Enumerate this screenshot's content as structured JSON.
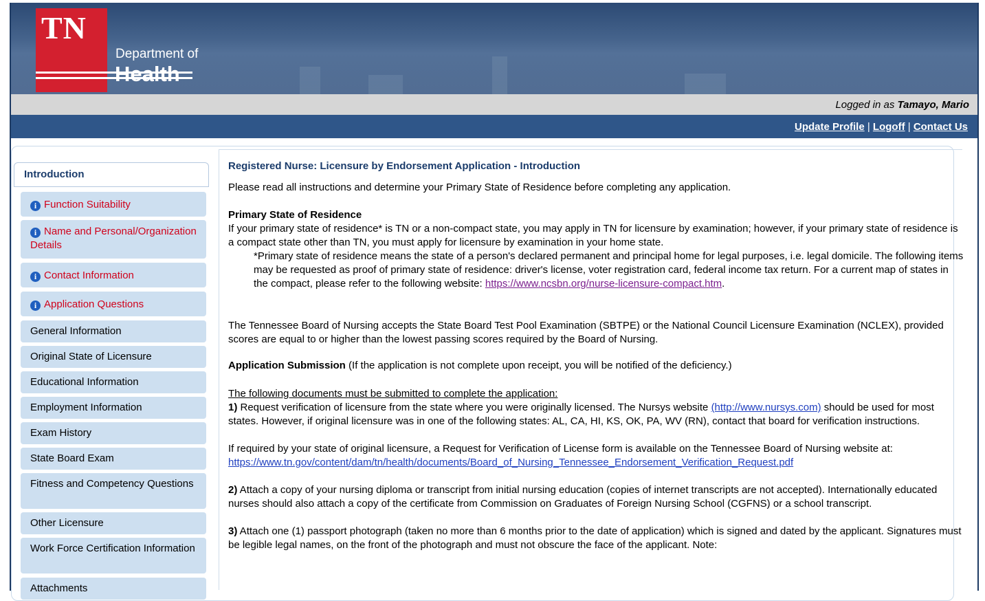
{
  "header": {
    "logo_abbrev": "TN",
    "logo_dept": "Department of",
    "logo_name": "Health",
    "logged_in_prefix": "Logged in as ",
    "logged_in_user": "Tamayo, Mario",
    "nav_links": [
      "Update Profile",
      "Logoff",
      "Contact Us"
    ],
    "nav_separator": "|"
  },
  "sidebar": {
    "active_tab": "Introduction",
    "items": [
      {
        "label": "Function Suitability",
        "warning": true
      },
      {
        "label": "Name and Personal/Organization Details",
        "warning": true
      },
      {
        "label": "Contact Information",
        "warning": true
      },
      {
        "label": "Application Questions",
        "warning": true
      },
      {
        "label": "General Information",
        "warning": false
      },
      {
        "label": "Original State of Licensure",
        "warning": false
      },
      {
        "label": "Educational Information",
        "warning": false
      },
      {
        "label": "Employment Information",
        "warning": false
      },
      {
        "label": "Exam History",
        "warning": false
      },
      {
        "label": "State Board Exam",
        "warning": false
      },
      {
        "label": "Fitness and Competency Questions",
        "warning": false
      },
      {
        "label": "Other Licensure",
        "warning": false
      },
      {
        "label": "Work Force Certification Information",
        "warning": false
      },
      {
        "label": "Attachments",
        "warning": false
      }
    ],
    "info_icon": "info-circle-icon"
  },
  "main": {
    "title": "Registered Nurse: Licensure by Endorsement Application - Introduction",
    "intro": "Please read all instructions and determine your Primary State of Residence before completing any application.",
    "psr_heading": "Primary State of Residence",
    "psr_text": "If your primary state of residence* is TN or a non-compact state, you may apply in TN for licensure by examination; however, if your primary state of residence is a compact state other than TN, you must apply for licensure by examination in your home state.",
    "psr_note": "*Primary state of residence means the state of a person's declared permanent and principal home for legal purposes, i.e. legal domicile. The following items may be requested as proof of primary state of residence: driver's license, voter registration card, federal income tax return. For a current map of states in the compact, please refer to the following website: ",
    "psr_link": "https://www.ncsbn.org/nurse-licensure-compact.htm",
    "psr_link_end": ".",
    "board_text": "The Tennessee Board of Nursing accepts the State Board Test Pool Examination (SBTPE) or the National Council Licensure Examination (NCLEX), provided scores are equal to or higher than the lowest passing scores required by the Board of Nursing.",
    "submission_heading": "Application Submission",
    "submission_note": " (If the application is not complete upon receipt, you will be notified of the deficiency.)",
    "docs_heading": "The following documents must be submitted to complete the application:",
    "item1_num": "1)",
    "item1_a": " Request verification of licensure from the state where you were originally licensed. The Nursys website ",
    "item1_link": "(http://www.nursys.com)",
    "item1_b": " should be used for most states. However, if original licensure was in one of the following states: AL, CA, HI, KS, OK, PA, WV (RN), contact that board for verification instructions.",
    "verify_text": "If required by your state of original licensure, a Request for Verification of License form is available on the Tennessee Board of Nursing website at: ",
    "verify_link": "https://www.tn.gov/content/dam/tn/health/documents/Board_of_Nursing_Tennessee_Endorsement_Verification_Request.pdf",
    "item2_num": "2)",
    "item2_text": " Attach a copy of your nursing diploma or transcript from initial nursing education (copies of internet transcripts are not accepted). Internationally educated nurses should also attach a copy of the certificate from Commission on Graduates of Foreign Nursing School (CGFNS) or a school transcript.",
    "item3_num": "3)",
    "item3_text": " Attach one (1) passport photograph (taken no more than 6 months prior to the date of application) which is signed and dated by the applicant. Signatures must be legible legal names, on the front of the photograph and must not obscure the face of the applicant. Note:"
  },
  "colors": {
    "banner": "#3d5a84",
    "nav_bar": "#2f5689",
    "logo_red": "#d3202f",
    "sidebar_item": "#cddff0",
    "warning_text": "#d0021b",
    "title_text": "#1b3c6b"
  }
}
